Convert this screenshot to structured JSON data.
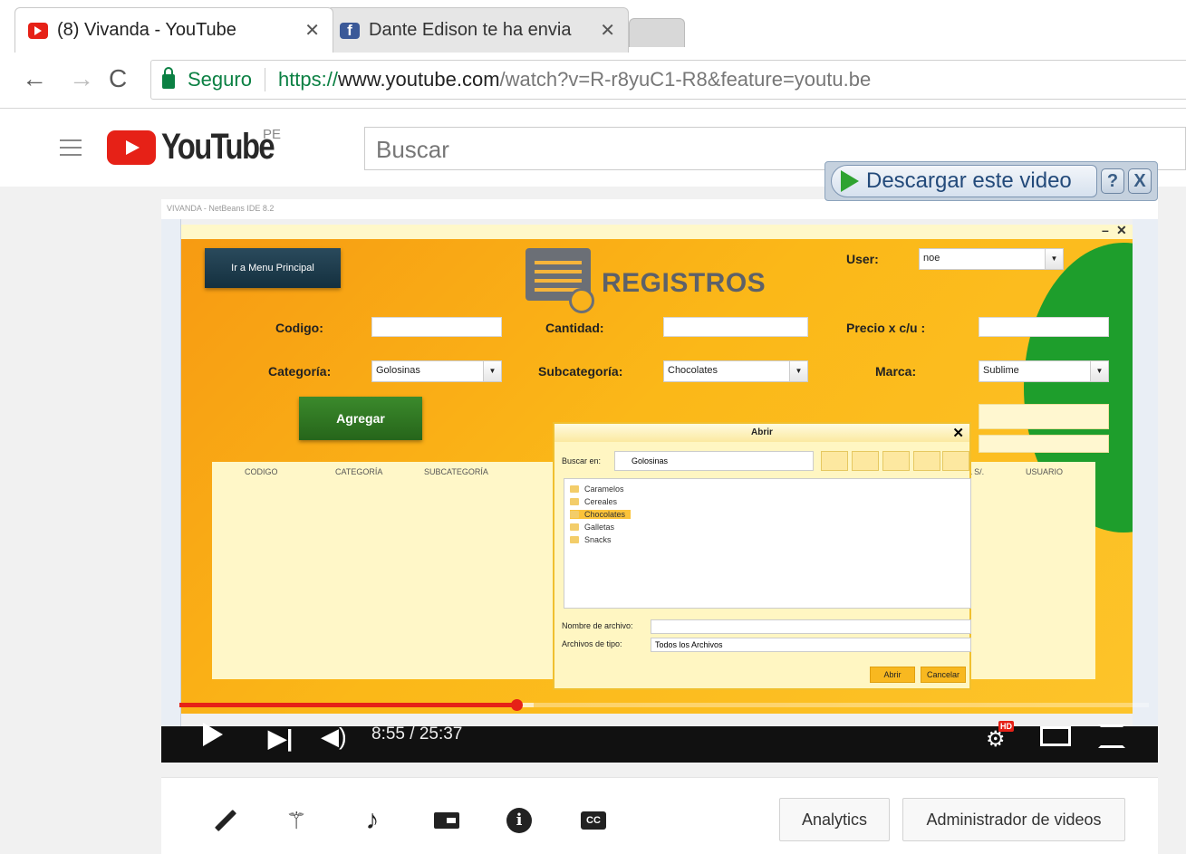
{
  "browser": {
    "tabs": [
      {
        "title": "(8) Vivanda - YouTube",
        "icon": "youtube-icon",
        "active": true
      },
      {
        "title": "Dante Edison te ha envia",
        "icon": "facebook-icon",
        "active": false
      }
    ],
    "close_glyph": "✕",
    "secure_label": "Seguro",
    "url_proto": "https://",
    "url_host": "www.youtube.com",
    "url_path": "/watch?v=R-r8yuC1-R8&feature=youtu.be"
  },
  "youtube": {
    "wordmark": "YouTube",
    "country": "PE",
    "search_placeholder": "Buscar"
  },
  "download_overlay": {
    "label": "Descargar este video",
    "help": "?",
    "close": "X"
  },
  "video": {
    "current_time": "8:55",
    "duration": "25:37",
    "time_display": "8:55 / 25:37",
    "progress_fraction": 0.348,
    "buffer_fraction": 0.365,
    "hd_badge": "HD"
  },
  "embedded_app": {
    "ide_title": "VIVANDA - NetBeans IDE 8.2",
    "menu_button": "Ir a Menu Principal",
    "heading": "REGISTROS",
    "user_label": "User:",
    "user_value": "noe",
    "codigo_label": "Codigo:",
    "cantidad_label": "Cantidad:",
    "precio_label": "Precio x c/u :",
    "categoria_label": "Categoría:",
    "categoria_value": "Golosinas",
    "subcategoria_label": "Subcategoría:",
    "subcategoria_value": "Chocolates",
    "marca_label": "Marca:",
    "marca_value": "Sublime",
    "add_button": "Agregar",
    "table_headers": [
      "CODIGO",
      "CATEGORÍA",
      "SUBCATEGORÍA",
      "AL S/.",
      "USUARIO"
    ],
    "dialog": {
      "title": "Abrir",
      "look_in_label": "Buscar en:",
      "look_in_value": "Golosinas",
      "folders": [
        "Caramelos",
        "Cereales",
        "Chocolates",
        "Galletas",
        "Snacks"
      ],
      "selected_folder": "Chocolates",
      "filename_label": "Nombre de archivo:",
      "filetype_label": "Archivos de tipo:",
      "filetype_value": "Todos los Archivos",
      "open_button": "Abrir",
      "cancel_button": "Cancelar"
    }
  },
  "bottom_toolbar": {
    "analytics_button": "Analytics",
    "admin_button": "Administrador de videos",
    "cc_label": "CC",
    "info_label": "i"
  }
}
